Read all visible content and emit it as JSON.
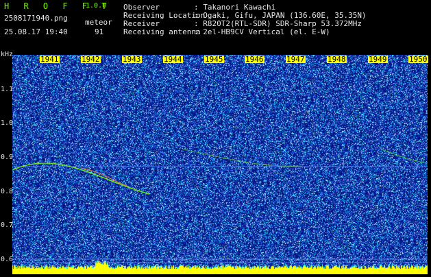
{
  "header": {
    "app_title": "H R O F F T",
    "version": "1.0.0",
    "filename": "2508171940.png",
    "meteor_label": "meteor",
    "datetime": "25.08.17 19:40",
    "meteor_count": "91"
  },
  "info": [
    {
      "key": "Observer",
      "value": ": Takanori Kawachi"
    },
    {
      "key": "Receiving Location",
      "value": ": Ogaki, Gifu, JAPAN (136.60E, 35.35N)"
    },
    {
      "key": "Receiver",
      "value": ": R820T2(RTL-SDR) SDR-Sharp 53.372MHz"
    },
    {
      "key": "Receiving antenna",
      "value": ": 2el-HB9CV Vertical (el. E-W)"
    }
  ],
  "axis": {
    "y_unit": "kHz",
    "y_ticks": [
      "1.1",
      "1.0",
      "0.9",
      "0.8",
      "0.7",
      "0.6"
    ],
    "x_ticks": [
      "1941",
      "1942",
      "1943",
      "1944",
      "1945",
      "1946",
      "1947",
      "1948",
      "1949",
      "1950"
    ]
  },
  "colors": {
    "background": "#06127a",
    "signal": "#7CFC00",
    "time_labels": "#ffff00"
  }
}
